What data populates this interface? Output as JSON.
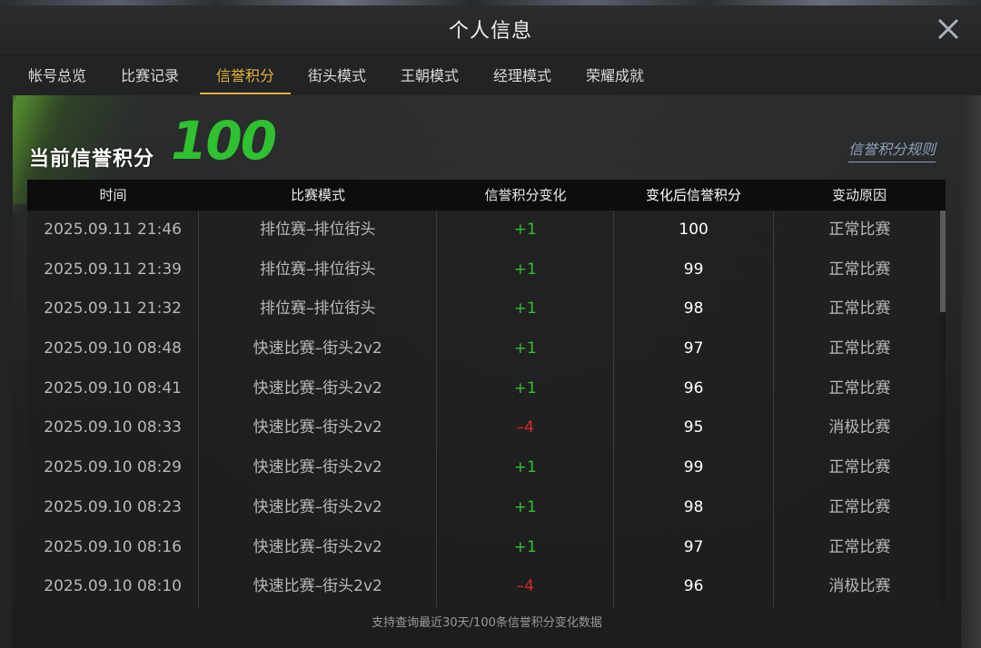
{
  "window": {
    "title": "个人信息",
    "close_icon": "close-icon"
  },
  "tabs": [
    {
      "label": "帐号总览",
      "active": false
    },
    {
      "label": "比赛记录",
      "active": false
    },
    {
      "label": "信誉积分",
      "active": true
    },
    {
      "label": "街头模式",
      "active": false
    },
    {
      "label": "王朝模式",
      "active": false
    },
    {
      "label": "经理模式",
      "active": false
    },
    {
      "label": "荣耀成就",
      "active": false
    }
  ],
  "credit": {
    "label": "当前信誉积分",
    "value": "100",
    "rules_link": "信誉积分规则"
  },
  "table": {
    "headers": [
      "时间",
      "比赛模式",
      "信誉积分变化",
      "变化后信誉积分",
      "变动原因"
    ],
    "rows": [
      {
        "time": "2025.09.11  21:46",
        "mode": "排位赛–排位街头",
        "change": "+1",
        "after": "100",
        "reason": "正常比赛"
      },
      {
        "time": "2025.09.11  21:39",
        "mode": "排位赛–排位街头",
        "change": "+1",
        "after": "99",
        "reason": "正常比赛"
      },
      {
        "time": "2025.09.11  21:32",
        "mode": "排位赛–排位街头",
        "change": "+1",
        "after": "98",
        "reason": "正常比赛"
      },
      {
        "time": "2025.09.10  08:48",
        "mode": "快速比赛–街头2v2",
        "change": "+1",
        "after": "97",
        "reason": "正常比赛"
      },
      {
        "time": "2025.09.10  08:41",
        "mode": "快速比赛–街头2v2",
        "change": "+1",
        "after": "96",
        "reason": "正常比赛"
      },
      {
        "time": "2025.09.10  08:33",
        "mode": "快速比赛–街头2v2",
        "change": "–4",
        "after": "95",
        "reason": "消极比赛"
      },
      {
        "time": "2025.09.10  08:29",
        "mode": "快速比赛–街头2v2",
        "change": "+1",
        "after": "99",
        "reason": "正常比赛"
      },
      {
        "time": "2025.09.10  08:23",
        "mode": "快速比赛–街头2v2",
        "change": "+1",
        "after": "98",
        "reason": "正常比赛"
      },
      {
        "time": "2025.09.10  08:16",
        "mode": "快速比赛–街头2v2",
        "change": "+1",
        "after": "97",
        "reason": "正常比赛"
      },
      {
        "time": "2025.09.10  08:10",
        "mode": "快速比赛–街头2v2",
        "change": "–4",
        "after": "96",
        "reason": "消极比赛"
      }
    ]
  },
  "footer": "支持查询最近30天/100条信誉积分变化数据",
  "colors": {
    "accent": "#e6b33a",
    "positive": "#2fc12f",
    "negative": "#d52a2a",
    "score": "#2fc12f"
  }
}
